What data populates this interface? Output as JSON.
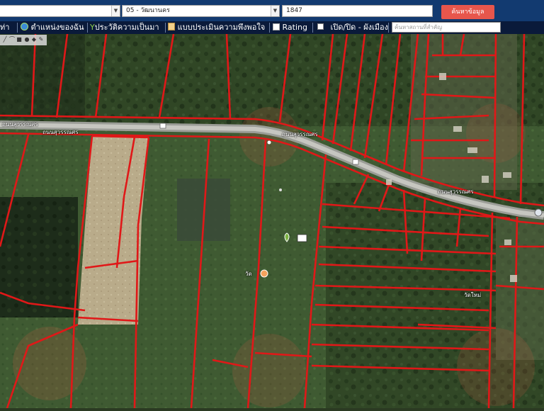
{
  "search": {
    "province_value": "",
    "district_value": "05 - วัฒนานคร",
    "parcel_value": "1847",
    "button_label": "ค้นหาข้อมูล",
    "place_placeholder": "ค้นหาสถานที่สำคัญ"
  },
  "menu": {
    "items": [
      {
        "label": "ท่า",
        "icon": "home-icon"
      },
      {
        "label": "ตำแหน่งของฉัน",
        "icon": "globe-icon"
      },
      {
        "label": "ประวัติความเป็นมา",
        "icon": "sprout-icon"
      },
      {
        "label": "แบบประเมินความพึงพอใจ",
        "icon": "notepad-icon"
      },
      {
        "label": "Rating",
        "icon": "chart-icon"
      },
      {
        "label": "เปิด/ปิด - ผังเมือง",
        "icon": "checkbox-icon"
      }
    ]
  },
  "toolbar": {
    "tools": [
      "line-tool-icon",
      "polyline-tool-icon",
      "square-tool-icon",
      "circle-tool-icon",
      "point-tool-icon",
      "clear-tool-icon"
    ]
  },
  "map": {
    "road_labels": [
      "ถนนสุวรรณศร",
      "ถนนสุวรรณศร",
      "ถนนสุวรรณศร",
      "ถนนสุวรรณศร"
    ],
    "poi_labels": [
      "วัด",
      "วัดใหม่"
    ],
    "parcel_color": "#e01818"
  }
}
